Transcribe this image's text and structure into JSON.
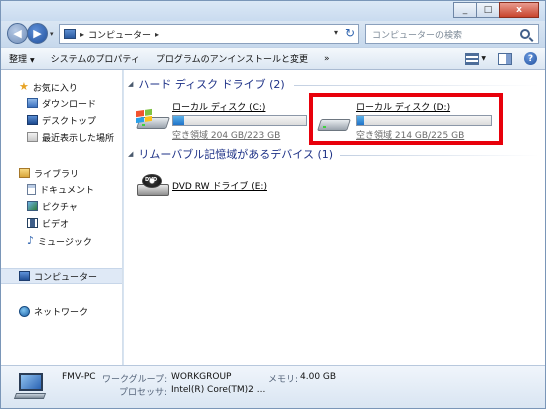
{
  "address": {
    "path": "コンピューター",
    "search_placeholder": "コンピューターの検索"
  },
  "toolbar": {
    "organize": "整理",
    "system_properties": "システムのプロパティ",
    "uninstall": "プログラムのアンインストールと変更",
    "more": "»"
  },
  "nav": {
    "favorites": "お気に入り",
    "downloads": "ダウンロード",
    "desktop": "デスクトップ",
    "recent": "最近表示した場所",
    "libraries": "ライブラリ",
    "documents": "ドキュメント",
    "pictures": "ピクチャ",
    "videos": "ビデオ",
    "music": "ミュージック",
    "computer": "コンピューター",
    "network": "ネットワーク"
  },
  "sections": {
    "hard_disks": "ハード ディスク ドライブ (2)",
    "removable": "リムーバブル記憶域があるデバイス (1)"
  },
  "drives": [
    {
      "name": "ローカル ディスク (C:)",
      "space": "空き領域 204 GB/223 GB",
      "used_fraction": 0.085
    },
    {
      "name": "ローカル ディスク (D:)",
      "space": "空き領域 214 GB/225 GB",
      "used_fraction": 0.05
    }
  ],
  "dvd": {
    "name": "DVD RW ドライブ (E:)",
    "icon_text": "DVD"
  },
  "details": {
    "pc_name": "FMV-PC",
    "workgroup_label": "ワークグループ:",
    "workgroup_value": "WORKGROUP",
    "memory_label": "メモリ:",
    "memory_value": "4.00 GB",
    "processor_label": "プロセッサ:",
    "processor_value": "Intel(R) Core(TM)2 ..."
  },
  "caption": {
    "minimize": "_",
    "maximize": "□",
    "close": "x"
  },
  "colors": {
    "highlight": "#e8000b",
    "section_title": "#1e3287",
    "bar_fill": "#1f72c8"
  }
}
